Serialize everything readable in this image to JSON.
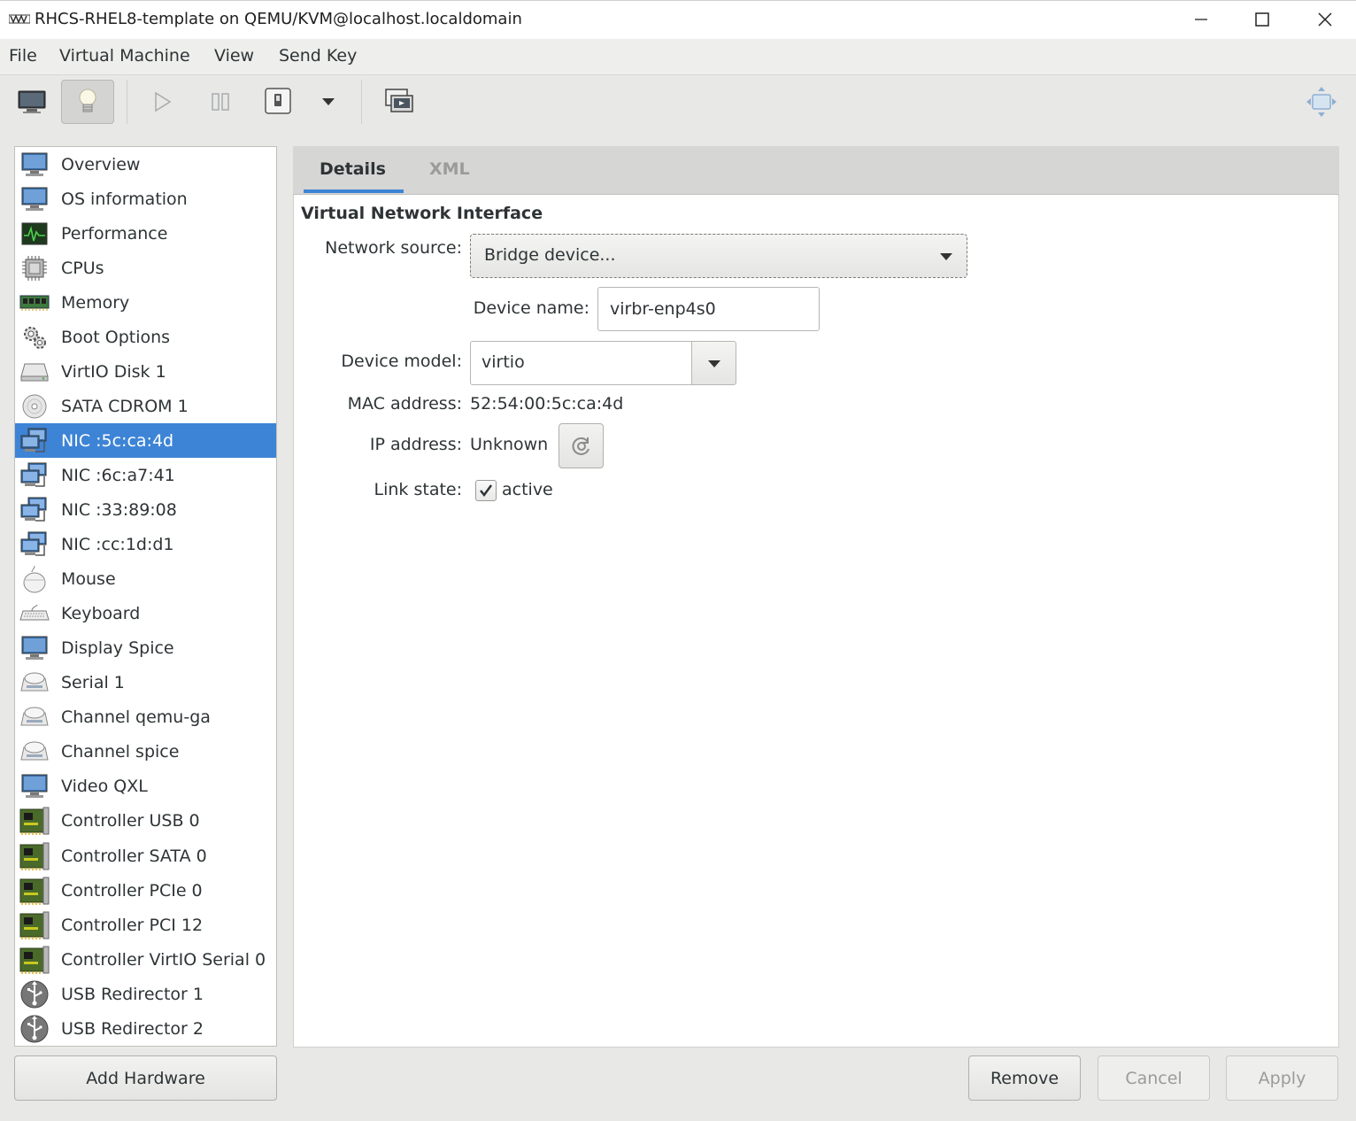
{
  "window": {
    "title": "RHCS-RHEL8-template on QEMU/KVM@localhost.localdomain"
  },
  "menubar": {
    "items": [
      "File",
      "Virtual Machine",
      "View",
      "Send Key"
    ]
  },
  "toolbar": {
    "buttons": [
      "console-monitor-icon",
      "details-lightbulb-icon",
      "run-play-icon",
      "pause-icon",
      "shutdown-power-icon",
      "shutdown-dropdown-icon",
      "snapshots-icon",
      "fullscreen-icon"
    ],
    "active": "details-lightbulb-icon"
  },
  "sidebar": {
    "items": [
      {
        "label": "Overview",
        "icon": "monitor-icon"
      },
      {
        "label": "OS information",
        "icon": "monitor-icon"
      },
      {
        "label": "Performance",
        "icon": "performance-graph-icon"
      },
      {
        "label": "CPUs",
        "icon": "cpu-chip-icon"
      },
      {
        "label": "Memory",
        "icon": "memory-module-icon"
      },
      {
        "label": "Boot Options",
        "icon": "gears-icon"
      },
      {
        "label": "VirtIO Disk 1",
        "icon": "hard-disk-icon"
      },
      {
        "label": "SATA CDROM 1",
        "icon": "cdrom-icon"
      },
      {
        "label": "NIC :5c:ca:4d",
        "icon": "network-card-icon"
      },
      {
        "label": "NIC :6c:a7:41",
        "icon": "network-card-icon"
      },
      {
        "label": "NIC :33:89:08",
        "icon": "network-card-icon"
      },
      {
        "label": "NIC :cc:1d:d1",
        "icon": "network-card-icon"
      },
      {
        "label": "Mouse",
        "icon": "mouse-icon"
      },
      {
        "label": "Keyboard",
        "icon": "keyboard-icon"
      },
      {
        "label": "Display Spice",
        "icon": "monitor-icon"
      },
      {
        "label": "Serial 1",
        "icon": "serial-device-icon"
      },
      {
        "label": "Channel qemu-ga",
        "icon": "serial-device-icon"
      },
      {
        "label": "Channel spice",
        "icon": "serial-device-icon"
      },
      {
        "label": "Video QXL",
        "icon": "monitor-icon"
      },
      {
        "label": "Controller USB 0",
        "icon": "controller-card-icon"
      },
      {
        "label": "Controller SATA 0",
        "icon": "controller-card-icon"
      },
      {
        "label": "Controller PCIe 0",
        "icon": "controller-card-icon"
      },
      {
        "label": "Controller PCI 12",
        "icon": "controller-card-icon"
      },
      {
        "label": "Controller VirtIO Serial 0",
        "icon": "controller-card-icon"
      },
      {
        "label": "USB Redirector 1",
        "icon": "usb-icon"
      },
      {
        "label": "USB Redirector 2",
        "icon": "usb-icon"
      }
    ],
    "selected": "NIC :5c:ca:4d",
    "add_hardware_label": "Add Hardware"
  },
  "tabs": {
    "details": "Details",
    "xml": "XML",
    "active": "Details"
  },
  "details": {
    "section_title": "Virtual Network Interface",
    "network_source_label": "Network source:",
    "network_source_value": "Bridge device...",
    "device_name_label": "Device name:",
    "device_name_value": "virbr-enp4s0",
    "device_model_label": "Device model:",
    "device_model_value": "virtio",
    "mac_label": "MAC address:",
    "mac_value": "52:54:00:5c:ca:4d",
    "ip_label": "IP address:",
    "ip_value": "Unknown",
    "link_state_label": "Link state:",
    "link_state_value": "active",
    "link_state_checked": true
  },
  "footer": {
    "remove_label": "Remove",
    "cancel_label": "Cancel",
    "apply_label": "Apply"
  },
  "colors": {
    "selection": "#3d84d6",
    "accent": "#3d84d6"
  }
}
